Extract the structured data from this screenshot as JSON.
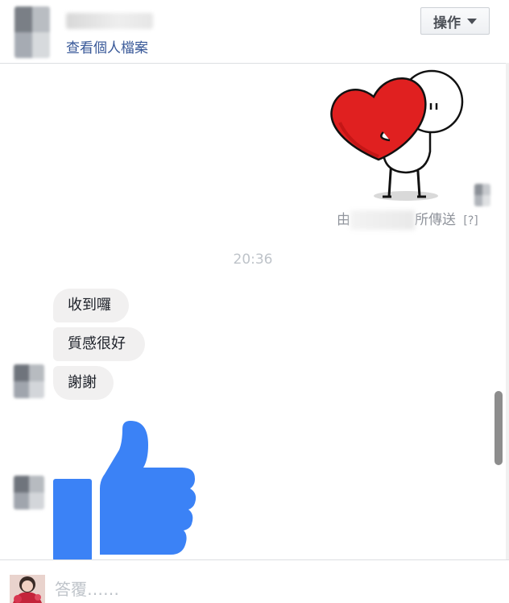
{
  "header": {
    "profile_link": "查看個人檔案",
    "actions_label": "操作"
  },
  "conversation": {
    "sent_by_prefix": "由",
    "sent_by_suffix": "所傳送",
    "help_mark": "[?]",
    "timestamp": "20:36",
    "messages": [
      "收到囉",
      "質感很好",
      "謝謝"
    ]
  },
  "reply": {
    "placeholder": "答覆……"
  },
  "colors": {
    "link": "#385898",
    "bubble": "#f1f0f0",
    "thumbs": "#3b82f6",
    "heart": "#e02020"
  },
  "icons": [
    "heart-hug-sticker",
    "thumbs-up-icon",
    "caret-down-icon"
  ]
}
